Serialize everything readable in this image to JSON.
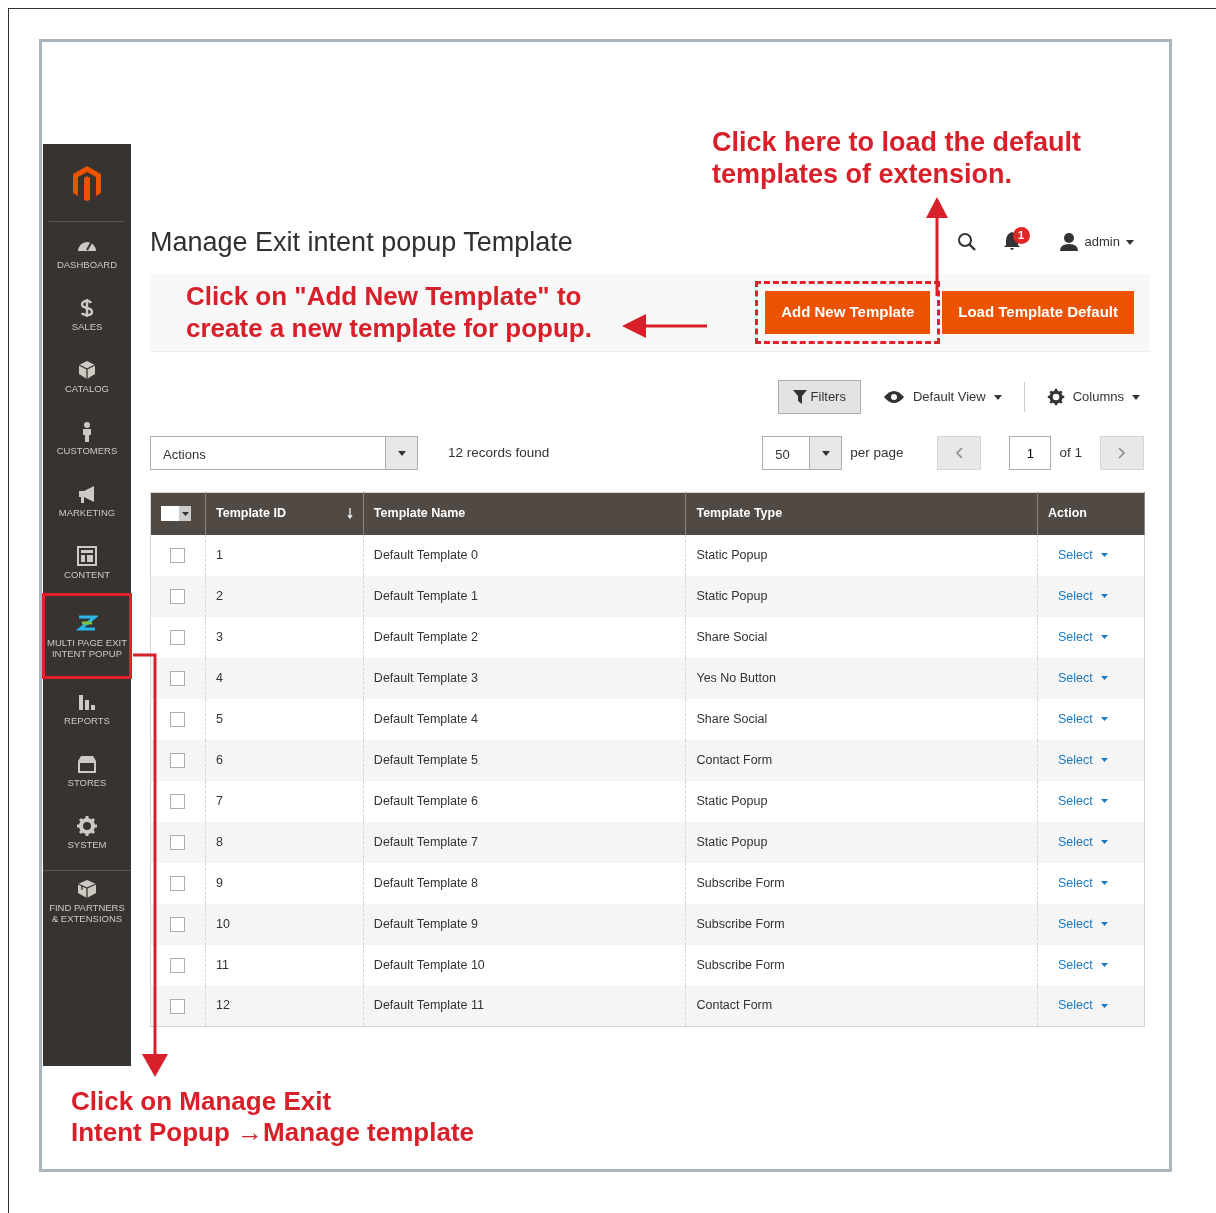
{
  "sidebar": {
    "items": [
      {
        "label": "DASHBOARD",
        "highlighted": false
      },
      {
        "label": "SALES",
        "highlighted": false
      },
      {
        "label": "CATALOG",
        "highlighted": false
      },
      {
        "label": "CUSTOMERS",
        "highlighted": false
      },
      {
        "label": "MARKETING",
        "highlighted": false
      },
      {
        "label": "CONTENT",
        "highlighted": false
      },
      {
        "label": "MULTI PAGE EXIT INTENT POPUP",
        "highlighted": true
      },
      {
        "label": "REPORTS",
        "highlighted": false
      },
      {
        "label": "STORES",
        "highlighted": false
      },
      {
        "label": "SYSTEM",
        "highlighted": false
      },
      {
        "label": "FIND PARTNERS & EXTENSIONS",
        "highlighted": false
      }
    ]
  },
  "page_title": "Manage Exit intent popup Template",
  "header": {
    "notification_count": "1",
    "user": "admin"
  },
  "action_buttons": [
    {
      "label": "Add New Template",
      "highlighted": true
    },
    {
      "label": "Load Template Default",
      "highlighted": false
    }
  ],
  "toolbar": {
    "filters": "Filters",
    "view": "Default View",
    "columns": "Columns"
  },
  "grid_controls": {
    "actions": "Actions",
    "records": "12 records found",
    "per_page_value": "50",
    "per_page_label": "per page",
    "page": "1",
    "page_of": "of 1"
  },
  "table": {
    "select_all_checked": false,
    "columns": [
      "Template ID",
      "Template Name",
      "Template Type",
      "Action"
    ],
    "rows": [
      {
        "checked": false,
        "id": "1",
        "name": "Default Template 0",
        "type": "Static Popup",
        "action": "Select"
      },
      {
        "checked": false,
        "id": "2",
        "name": "Default Template 1",
        "type": "Static Popup",
        "action": "Select"
      },
      {
        "checked": false,
        "id": "3",
        "name": "Default Template 2",
        "type": "Share Social",
        "action": "Select"
      },
      {
        "checked": false,
        "id": "4",
        "name": "Default Template 3",
        "type": "Yes No Button",
        "action": "Select"
      },
      {
        "checked": false,
        "id": "5",
        "name": "Default Template 4",
        "type": "Share Social",
        "action": "Select"
      },
      {
        "checked": false,
        "id": "6",
        "name": "Default Template 5",
        "type": "Contact Form",
        "action": "Select"
      },
      {
        "checked": false,
        "id": "7",
        "name": "Default Template 6",
        "type": "Static Popup",
        "action": "Select"
      },
      {
        "checked": false,
        "id": "8",
        "name": "Default Template 7",
        "type": "Static Popup",
        "action": "Select"
      },
      {
        "checked": false,
        "id": "9",
        "name": "Default Template 8",
        "type": "Subscribe Form",
        "action": "Select"
      },
      {
        "checked": false,
        "id": "10",
        "name": "Default Template 9",
        "type": "Subscribe Form",
        "action": "Select"
      },
      {
        "checked": false,
        "id": "11",
        "name": "Default Template 10",
        "type": "Subscribe Form",
        "action": "Select"
      },
      {
        "checked": false,
        "id": "12",
        "name": "Default Template 11",
        "type": "Contact Form",
        "action": "Select"
      }
    ]
  },
  "annotations": {
    "top": [
      "Click here to load the default",
      "templates of extension."
    ],
    "middle": [
      "Click on \"Add New Template\" to",
      "create a new template for popup."
    ],
    "bottom": [
      "Click on Manage Exit",
      "Intent Popup →Manage template"
    ]
  }
}
